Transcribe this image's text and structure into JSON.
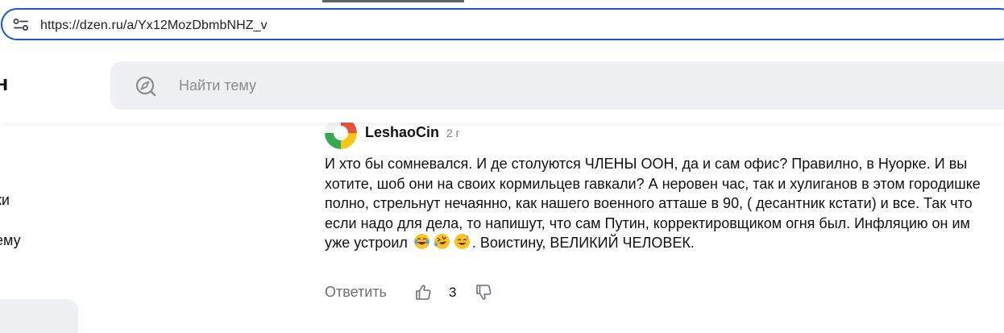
{
  "browser": {
    "url": "https://dzen.ru/a/Yx12MozDbmbNHZ_v"
  },
  "header": {
    "logo_fragment": "н",
    "search": {
      "placeholder": "Найти тему"
    }
  },
  "sidebar": {
    "items": [
      {
        "label": "ки"
      },
      {
        "label": "ему"
      }
    ]
  },
  "comment": {
    "author": "LeshaoCin",
    "age": "2 г",
    "text_main": "И хто бы сомневался. И де столуются ЧЛЕНЫ ООН, да и сам офис? Правилно, в Нуорке. И вы хотите, шоб они на своих кормильцев гавкали? А неровен час, так и хулиганов в этом городишке полно, стрельнут нечаянно, как нашего военного атташе в 90, ( десантник кстати) и все. Так что если надо для дела, то напишут, что сам Путин, корректировщиком огня был. Инфляцию он им уже устроил",
    "text_end": ". Воистину, ВЕЛИКИЙ ЧЕЛОВЕК.",
    "emojis": [
      "laughing-tears-emoji",
      "rolling-laughing-emoji",
      "sweat-smile-emoji"
    ],
    "reply_label": "Ответить",
    "likes": "3"
  }
}
